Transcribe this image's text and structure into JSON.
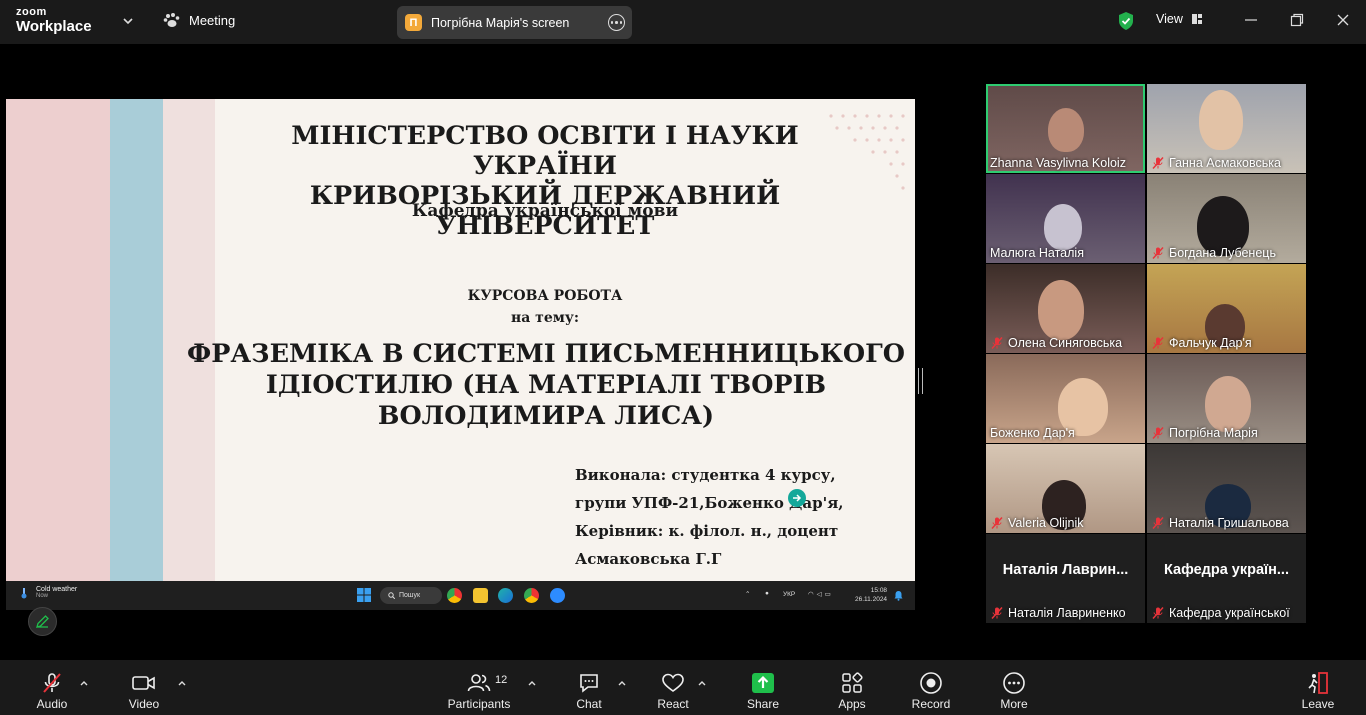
{
  "app": {
    "logo_top": "zoom",
    "logo_bottom": "Workplace",
    "meeting_label": "Meeting",
    "share_badge": "П",
    "share_title": "Погрібна Марія's screen",
    "view_label": "View"
  },
  "slide": {
    "line1": "МІНІСТЕРСТВО ОСВІТИ І НАУКИ УКРАЇНИ",
    "line2": "КРИВОРІЗЬКИЙ ДЕРЖАВНИЙ УНІВЕРСИТЕТ",
    "department": "Кафедра української мови",
    "work_type": "КУРСОВА РОБОТА",
    "on_topic": "на тему:",
    "topic1": "ФРАЗЕМІКА В СИСТЕМІ ПИСЬМЕННИЦЬКОГО",
    "topic2": "ІДІОСТИЛЮ (НА МАТЕРІАЛІ ТВОРІВ",
    "topic3": "ВОЛОДИМИРА ЛИСА)",
    "author1": "Виконала: студентка 4 курсу,",
    "author2": "групи УПФ-21,Боженко Дар'я,",
    "author3": "Керівник: к. філол. н.,  доцент",
    "author4": "Асмаковська Г.Г"
  },
  "win_taskbar": {
    "weather_title": "Cold weather",
    "weather_sub": "Now",
    "search_label": "Пошук",
    "lang": "УКР",
    "time": "15:08",
    "date": "26.11.2024"
  },
  "participants_tiles": [
    {
      "name": "Zhanna Vasylivna Koloiz",
      "muted": false,
      "active": true
    },
    {
      "name": "Ганна Асмаковська",
      "muted": true
    },
    {
      "name": "Малюга Наталія",
      "muted": false
    },
    {
      "name": "Богдана Лубенець",
      "muted": true
    },
    {
      "name": "Олена Синяговська",
      "muted": true
    },
    {
      "name": "Фальчук Дар'я",
      "muted": true
    },
    {
      "name": "Боженко Дар'я",
      "muted": false
    },
    {
      "name": "Погрібна Марія",
      "muted": true
    },
    {
      "name": "Valeria Olijnik",
      "muted": true
    },
    {
      "name": "Наталія Гришальова",
      "muted": true
    },
    {
      "name": "Наталія Лаврин...",
      "label": "Наталія Лавриненко",
      "muted": true,
      "video": false
    },
    {
      "name": "Кафедра україн...",
      "label": "Кафедра української",
      "muted": true,
      "video": false
    }
  ],
  "toolbar": {
    "audio": "Audio",
    "video": "Video",
    "participants": "Participants",
    "participants_count": "12",
    "chat": "Chat",
    "react": "React",
    "share": "Share",
    "apps": "Apps",
    "record": "Record",
    "more": "More",
    "leave": "Leave"
  },
  "colors": {
    "share_green": "#1fbf4b",
    "active_border": "#2ecc71",
    "mute_red": "#e8333a",
    "band_pink": "#edcfcf",
    "band_blue": "#a9cdd8",
    "band_pale": "#efe0de"
  }
}
